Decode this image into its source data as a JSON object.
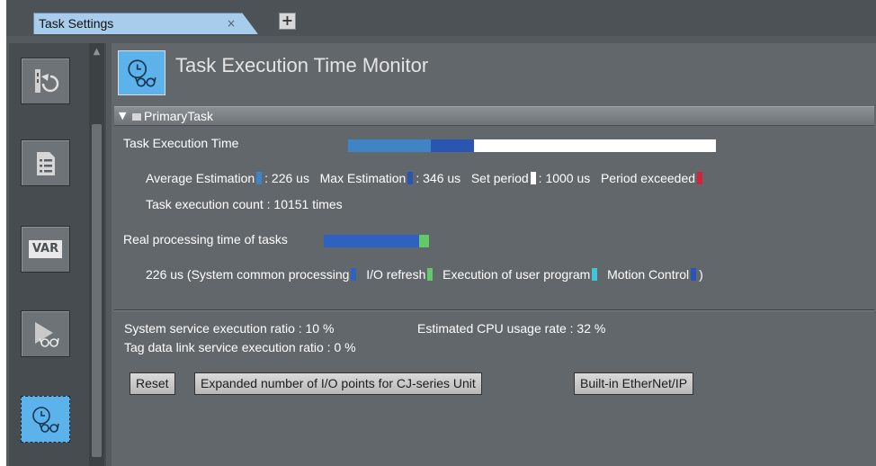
{
  "tab": {
    "title": "Task Settings",
    "close": "×",
    "add": "+"
  },
  "sidebar": {
    "items": [
      {
        "name": "task-setup",
        "icon": "task-restart-icon"
      },
      {
        "name": "settings-list",
        "icon": "list-document-icon"
      },
      {
        "name": "variables",
        "icon": "var-icon",
        "label": "VAR"
      },
      {
        "name": "program-assignment",
        "icon": "play-glasses-icon"
      },
      {
        "name": "task-execution-time-monitor",
        "icon": "clock-glasses-icon",
        "active": true
      }
    ]
  },
  "header": {
    "title": "Task Execution Time Monitor",
    "icon": "clock-glasses-icon"
  },
  "section": {
    "label": "PrimaryTask",
    "expanded": true
  },
  "task_execution_time": {
    "label": "Task Execution Time",
    "average_label": "Average Estimation",
    "average_value": ": 226 us",
    "max_label": "Max Estimation",
    "max_value": ": 346 us",
    "period_label": "Set period",
    "period_value": ": 1000 us",
    "exceeded_label": "Period exceeded",
    "count_text": "Task execution count : 10151 times",
    "colors": {
      "average": "#3f85c6",
      "max": "#2a55b3",
      "period": "#ffffff",
      "exceeded": "#d7233a"
    }
  },
  "real_processing": {
    "label": "Real processing time of tasks",
    "total": "226 us (",
    "system_label": "System common processing",
    "io_label": "I/O refresh",
    "user_label": "Execution of user program",
    "motion_label": "Motion Control",
    "close_paren": ")",
    "colors": {
      "system": "#2e62c0",
      "io": "#63c86a",
      "user": "#41c4d8",
      "motion": "#2a55b3"
    }
  },
  "ratios": {
    "system_service": "System service execution ratio : 10 %",
    "cpu_usage": "Estimated CPU usage rate : 32 %",
    "tag_data_link": "Tag data link service execution ratio : 0 %"
  },
  "buttons": {
    "reset": "Reset",
    "expanded_io": "Expanded number of I/O points for CJ-series Unit",
    "ethernet": "Built-in EtherNet/IP"
  }
}
